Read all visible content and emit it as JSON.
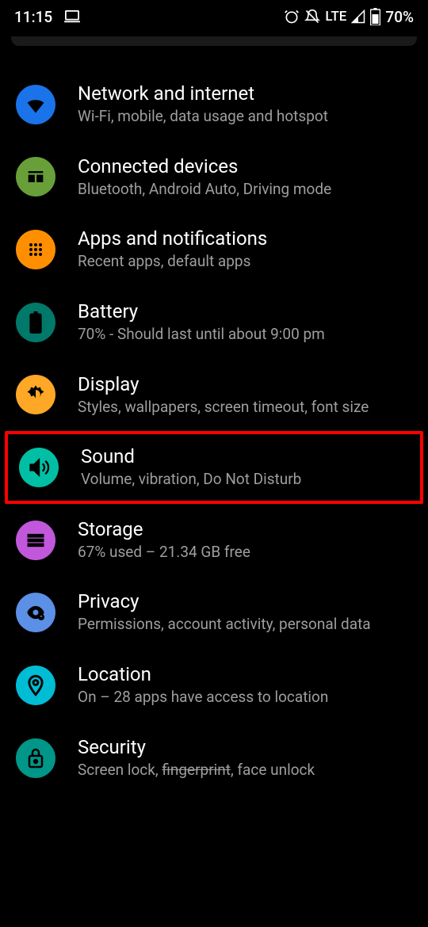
{
  "status_bar": {
    "time": "11:15",
    "network_label": "LTE",
    "battery": "70%"
  },
  "settings": {
    "items": [
      {
        "title": "Network and internet",
        "subtitle": "Wi-Fi, mobile, data usage and hotspot",
        "icon_bg": "#1a73e8"
      },
      {
        "title": "Connected devices",
        "subtitle": "Bluetooth, Android Auto, Driving mode",
        "icon_bg": "#689f38"
      },
      {
        "title": "Apps and notifications",
        "subtitle": "Recent apps, default apps",
        "icon_bg": "#ff8f00"
      },
      {
        "title": "Battery",
        "subtitle": "70% - Should last until about 9:00 pm",
        "icon_bg": "#00796b"
      },
      {
        "title": "Display",
        "subtitle": "Styles, wallpapers, screen timeout, font size",
        "icon_bg": "#ffa726"
      },
      {
        "title": "Sound",
        "subtitle": "Volume, vibration, Do Not Disturb",
        "icon_bg": "#00bfa5",
        "highlighted": true
      },
      {
        "title": "Storage",
        "subtitle": "67% used – 21.34 GB free",
        "icon_bg": "#c158dc"
      },
      {
        "title": "Privacy",
        "subtitle": "Permissions, account activity, personal data",
        "icon_bg": "#5c8fe6"
      },
      {
        "title": "Location",
        "subtitle": "On – 28 apps have access to location",
        "icon_bg": "#00bcd4"
      },
      {
        "title": "Security",
        "subtitle_parts": [
          "Screen lock, ",
          "fingerprint",
          ", face unlock"
        ],
        "icon_bg": "#009688"
      }
    ]
  }
}
